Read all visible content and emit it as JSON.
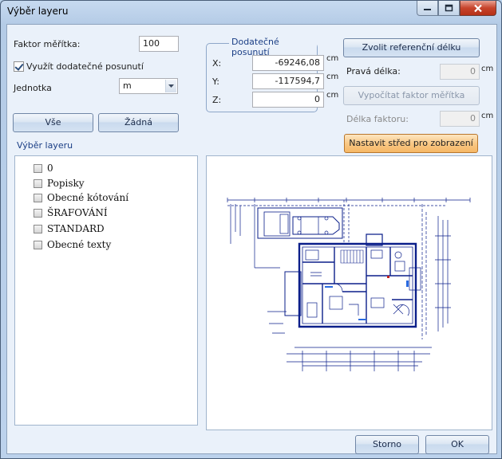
{
  "window": {
    "title": "Výběr layeru",
    "controls": {
      "minimize": "minimize-icon",
      "maximize": "maximize-icon",
      "close": "close-icon"
    }
  },
  "scale": {
    "label": "Faktor měřítka:",
    "value": "100"
  },
  "use_offset": {
    "label": "Využít dodatečné posunutí",
    "checked": true
  },
  "unit": {
    "label": "Jednotka",
    "value": "m"
  },
  "buttons": {
    "all": "Vše",
    "none": "Žádná",
    "cancel": "Storno",
    "ok": "OK"
  },
  "layer_section": {
    "title": "Výběr layeru",
    "layers": [
      "0",
      "Popisky",
      "Obecné kótování",
      "ŠRAFOVÁNÍ",
      "STANDARD",
      "Obecné texty"
    ]
  },
  "offset_group": {
    "title": "Dodatečné posunutí",
    "x_label": "X:",
    "x_value": "-69246,08",
    "x_unit": "cm",
    "y_label": "Y:",
    "y_value": "-117594,7",
    "y_unit": "cm",
    "z_label": "Z:",
    "z_value": "0",
    "z_unit": "cm"
  },
  "reference": {
    "choose_length": "Zvolit referenční délku",
    "real_length_label": "Pravá délka:",
    "real_length_value": "0",
    "real_length_unit": "cm",
    "compute_scale": "Vypočítat faktor měřítka",
    "factor_length_label": "Délka faktoru:",
    "factor_length_value": "0",
    "factor_length_unit": "cm",
    "set_center": "Nastavit střed pro zobrazení"
  },
  "colors": {
    "accent": "#1a3e85",
    "drawing": "#0b1f8a",
    "hot": "#f9c885"
  }
}
